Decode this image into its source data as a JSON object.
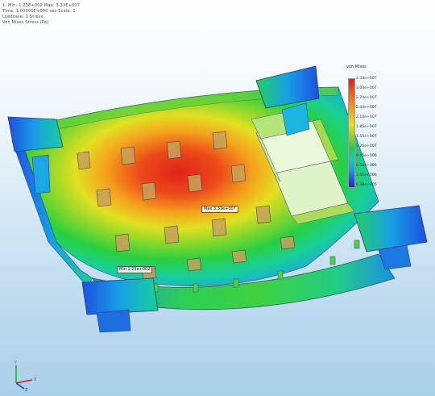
{
  "info": {
    "lines": [
      "1:   Min: 1.23E+002  Max: 3.33E+007",
      "Time: 1.00000E+000 sec  Scale: 1",
      "Loadcase: 1   Stress",
      "Von Mises  Stress (Pa)"
    ]
  },
  "legend": {
    "title": "von Mises",
    "labels": [
      "3.33e+007",
      "3.03e+007",
      "2.74e+007",
      "2.44e+007",
      "2.14e+007",
      "1.85e+007",
      "1.55e+007",
      "1.25e+007",
      "9.55e+006",
      "6.58e+006",
      "3.61e+006",
      "6.38e+005"
    ],
    "colors": {
      "max": "#e0201a",
      "mid": "#e8e020",
      "min": "#2222c8"
    }
  },
  "probes": {
    "max_label": "Max 3.33e+007",
    "min_label": "Min 1.23e+002"
  },
  "triad": {
    "x": "X",
    "y": "Y",
    "z": "Z"
  }
}
